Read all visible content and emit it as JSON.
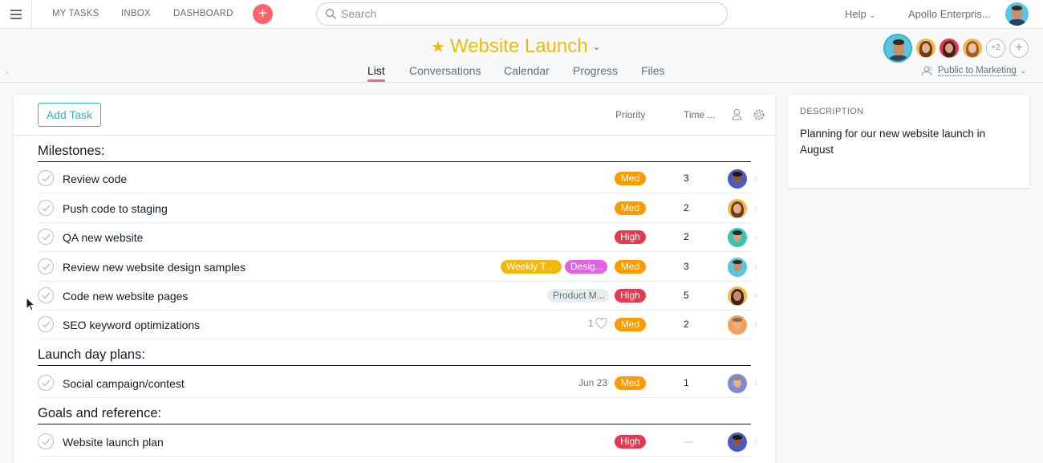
{
  "topbar": {
    "nav": [
      "MY TASKS",
      "INBOX",
      "DASHBOARD"
    ],
    "search_placeholder": "Search",
    "help_label": "Help",
    "org_label": "Apollo Enterpris..."
  },
  "project": {
    "title": "Website Launch",
    "tabs": [
      "List",
      "Conversations",
      "Calendar",
      "Progress",
      "Files"
    ],
    "active_tab": "List",
    "extra_members": "+2",
    "privacy_label": "Public to Marketing"
  },
  "task_list": {
    "add_task_label": "Add Task",
    "columns": {
      "priority": "Priority",
      "time": "Time ..."
    },
    "sections": [
      {
        "title": "Milestones:",
        "tasks": [
          {
            "name": "Review code",
            "priority": "Med",
            "time": "3"
          },
          {
            "name": "Push code to staging",
            "priority": "Med",
            "time": "2"
          },
          {
            "name": "QA new website",
            "priority": "High",
            "time": "2"
          },
          {
            "name": "Review new website design samples",
            "tags": [
              "Weekly T...",
              "Desig..."
            ],
            "priority": "Med",
            "time": "3"
          },
          {
            "name": "Code new website pages",
            "tags": [
              "Product M..."
            ],
            "priority": "High",
            "time": "5"
          },
          {
            "name": "SEO keyword optimizations",
            "likes": "1",
            "priority": "Med",
            "time": "2"
          }
        ]
      },
      {
        "title": "Launch day plans:",
        "tasks": [
          {
            "name": "Social campaign/contest",
            "due": "Jun 23",
            "priority": "Med",
            "time": "1"
          }
        ]
      },
      {
        "title": "Goals and reference:",
        "tasks": [
          {
            "name": "Website launch plan",
            "priority": "High",
            "time": "—"
          }
        ]
      }
    ]
  },
  "description": {
    "label": "DESCRIPTION",
    "text": "Planning for our new website launch in August"
  },
  "colors": {
    "accent": "#fc636b",
    "project_title": "#f2b90c",
    "med": "#fd9a00",
    "high": "#e8384f",
    "tag_weekly": "#f2b90c",
    "tag_design": "#e362e3",
    "tag_product": "#e8ecee",
    "add_task": "#2fb5c6"
  }
}
